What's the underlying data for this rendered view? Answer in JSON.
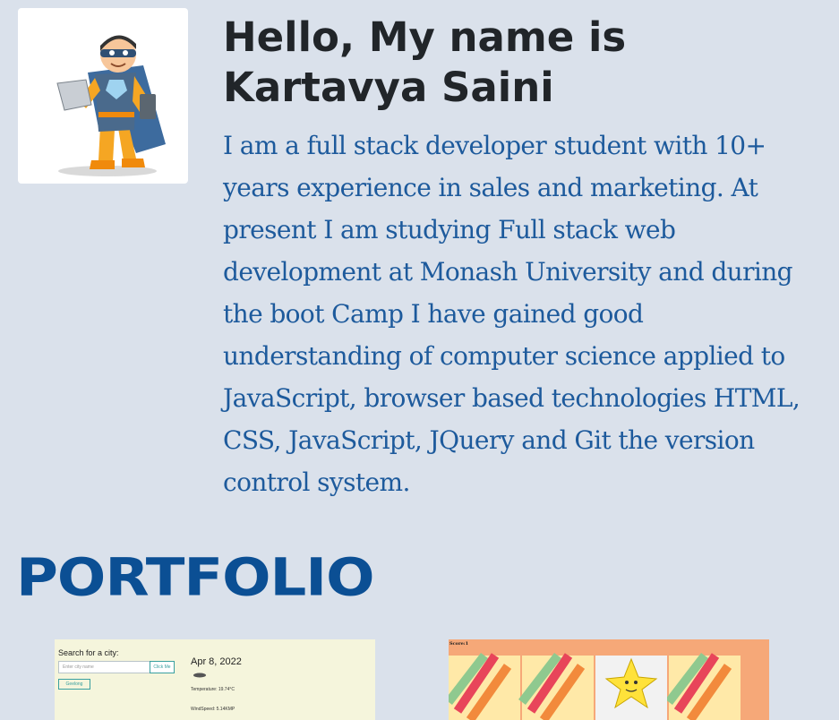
{
  "intro": {
    "title": "Hello, My name is Kartavya Saini",
    "text": "I am a full stack developer student with 10+ years experience in sales and marketing. At present I am studying Full stack web development at Monash University and during the boot Camp I have gained good understanding of computer science applied to JavaScript, browser based technologies HTML, CSS, JavaScript, JQuery and Git the version control system."
  },
  "avatar": {
    "icon": "superhero-developer-illustration"
  },
  "portfolio": {
    "heading": "PORTFOLIO",
    "projects": [
      {
        "search_label": "Search for a city:",
        "input_placeholder": "Enter city name",
        "button_label": "Click Me",
        "history_item": "Geelong",
        "date": "Apr 8, 2022",
        "temperature": "Temperature: 19.74°C",
        "wind": "WindSpeed: 5.14KMP"
      },
      {
        "score_label": "Score:1"
      }
    ]
  },
  "colors": {
    "background": "#dae1eb",
    "title": "#212529",
    "body_text": "#1d5a9c",
    "portfolio_heading": "#0b4f94"
  }
}
